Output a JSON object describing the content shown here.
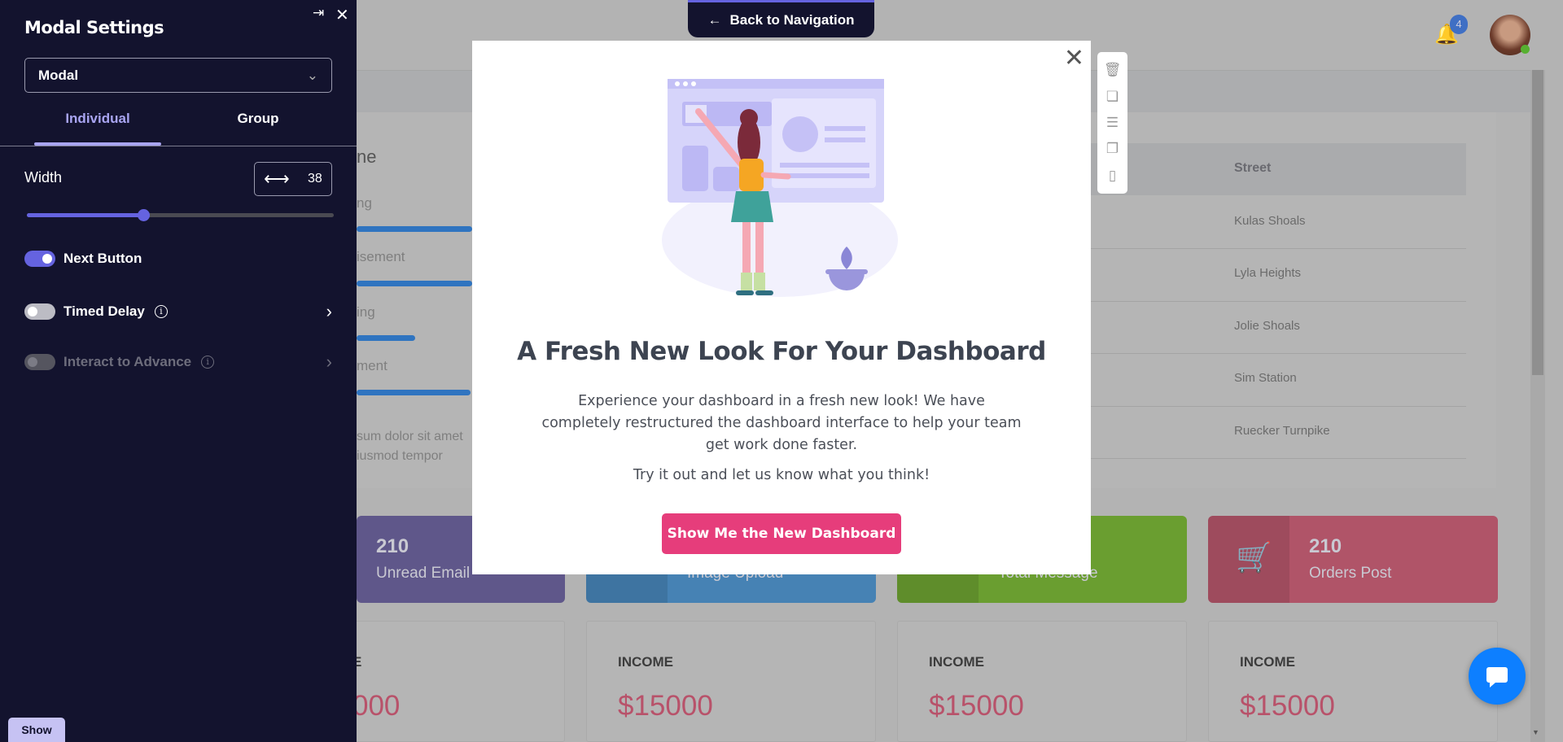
{
  "sidebar": {
    "title": "Modal Settings",
    "select_value": "Modal",
    "tabs": [
      "Individual",
      "Group"
    ],
    "width_label": "Width",
    "width_value": "38",
    "width_fraction": 0.38,
    "toggles": [
      {
        "label": "Next Button",
        "on": true
      },
      {
        "label": "Timed Delay",
        "on": false
      },
      {
        "label": "Interact to Advance",
        "on": false,
        "disabled": true
      }
    ],
    "show_label": "Show"
  },
  "nav": {
    "back_label": "Back to Navigation",
    "notification_count": "4"
  },
  "background": {
    "partial_title": "ne",
    "partial_labels": [
      "ng",
      "isement",
      "ing",
      "ment"
    ],
    "progress": [
      1,
      1,
      0.3,
      0.99
    ],
    "lorem": [
      "sum dolor sit amet",
      "iusmod tempor"
    ],
    "table": {
      "header": "Street",
      "rows": [
        "Kulas Shoals",
        "Lyla Heights",
        "Jolie Shoals",
        "Sim Station",
        "Ruecker Turnpike"
      ]
    },
    "stats": [
      {
        "num": "210",
        "label": "Unread Email",
        "color": "#5f578a"
      },
      {
        "num": "",
        "label": "Image Upload",
        "color": "#4682b4"
      },
      {
        "num": "",
        "label": "Total Message",
        "color": "#6a9e30"
      },
      {
        "num": "210",
        "label": "Orders Post",
        "color": "#b05468"
      }
    ],
    "income": [
      {
        "title": "E",
        "value": "000"
      },
      {
        "title": "INCOME",
        "value": "$15000"
      },
      {
        "title": "INCOME",
        "value": "$15000"
      },
      {
        "title": "INCOME",
        "value": "$15000"
      }
    ]
  },
  "modal": {
    "title": "A Fresh New Look For Your Dashboard",
    "body": "Experience your dashboard in a fresh new look! We have completely restructured the dashboard interface to help your team get work done faster.",
    "body2": "Try it out and let us know what you think!",
    "cta": "Show Me the New Dashboard"
  },
  "colors": {
    "sidebar_bg": "#13132e",
    "accent": "#6563e0",
    "cta": "#e63d7b"
  }
}
